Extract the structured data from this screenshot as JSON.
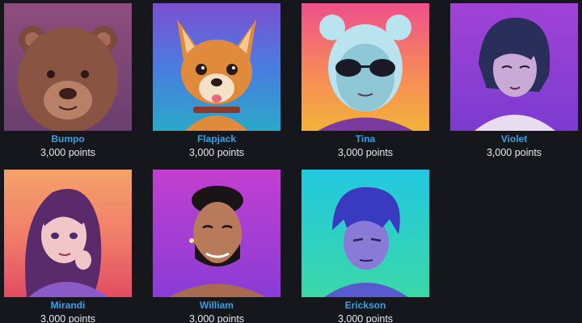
{
  "avatars": [
    {
      "name": "Bumpo",
      "points": "3,000 points"
    },
    {
      "name": "Flapjack",
      "points": "3,000 points"
    },
    {
      "name": "Tina",
      "points": "3,000 points"
    },
    {
      "name": "Violet",
      "points": "3,000 points"
    },
    {
      "name": "Mirandi",
      "points": "3,000 points"
    },
    {
      "name": "William",
      "points": "3,000 points"
    },
    {
      "name": "Erickson",
      "points": "3,000 points"
    }
  ],
  "colors": {
    "background": "#15171c",
    "name_text": "#3b9fe0",
    "points_text": "#e8e9ec"
  }
}
